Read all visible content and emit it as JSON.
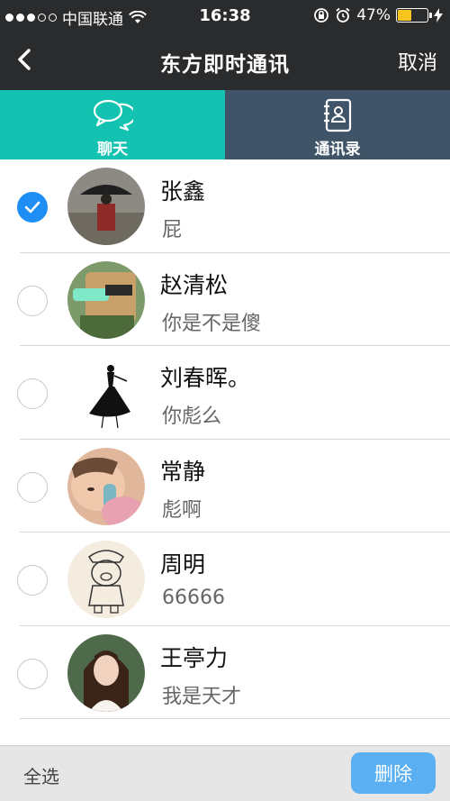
{
  "status_bar": {
    "carrier": "中国联通",
    "time": "16:38",
    "battery_percent": "47%",
    "battery_level": 0.47,
    "battery_color": "#f7c51e"
  },
  "nav": {
    "title": "东方即时通讯",
    "cancel_label": "取消",
    "back_icon": "chevron-left-icon"
  },
  "tabs": [
    {
      "label": "聊天",
      "icon": "chat-bubbles-icon",
      "active": true,
      "color": "#13c2b0"
    },
    {
      "label": "通讯录",
      "icon": "contact-book-icon",
      "active": false,
      "color": "#3f5467"
    }
  ],
  "contacts": [
    {
      "name": "张鑫",
      "message": "屁",
      "selected": true
    },
    {
      "name": "赵清松",
      "message": "你是不是傻",
      "selected": false
    },
    {
      "name": "刘春晖。",
      "message": "你彪么",
      "selected": false
    },
    {
      "name": "常静",
      "message": "彪啊",
      "selected": false
    },
    {
      "name": "周明",
      "message": "66666",
      "selected": false
    },
    {
      "name": "王亭力",
      "message": "我是天才",
      "selected": false
    }
  ],
  "bottom_bar": {
    "select_all_label": "全选",
    "delete_label": "删除"
  },
  "colors": {
    "accent": "#1e8ef5",
    "delete_button": "#5ab0f2",
    "nav_background": "#2a2b2d"
  }
}
